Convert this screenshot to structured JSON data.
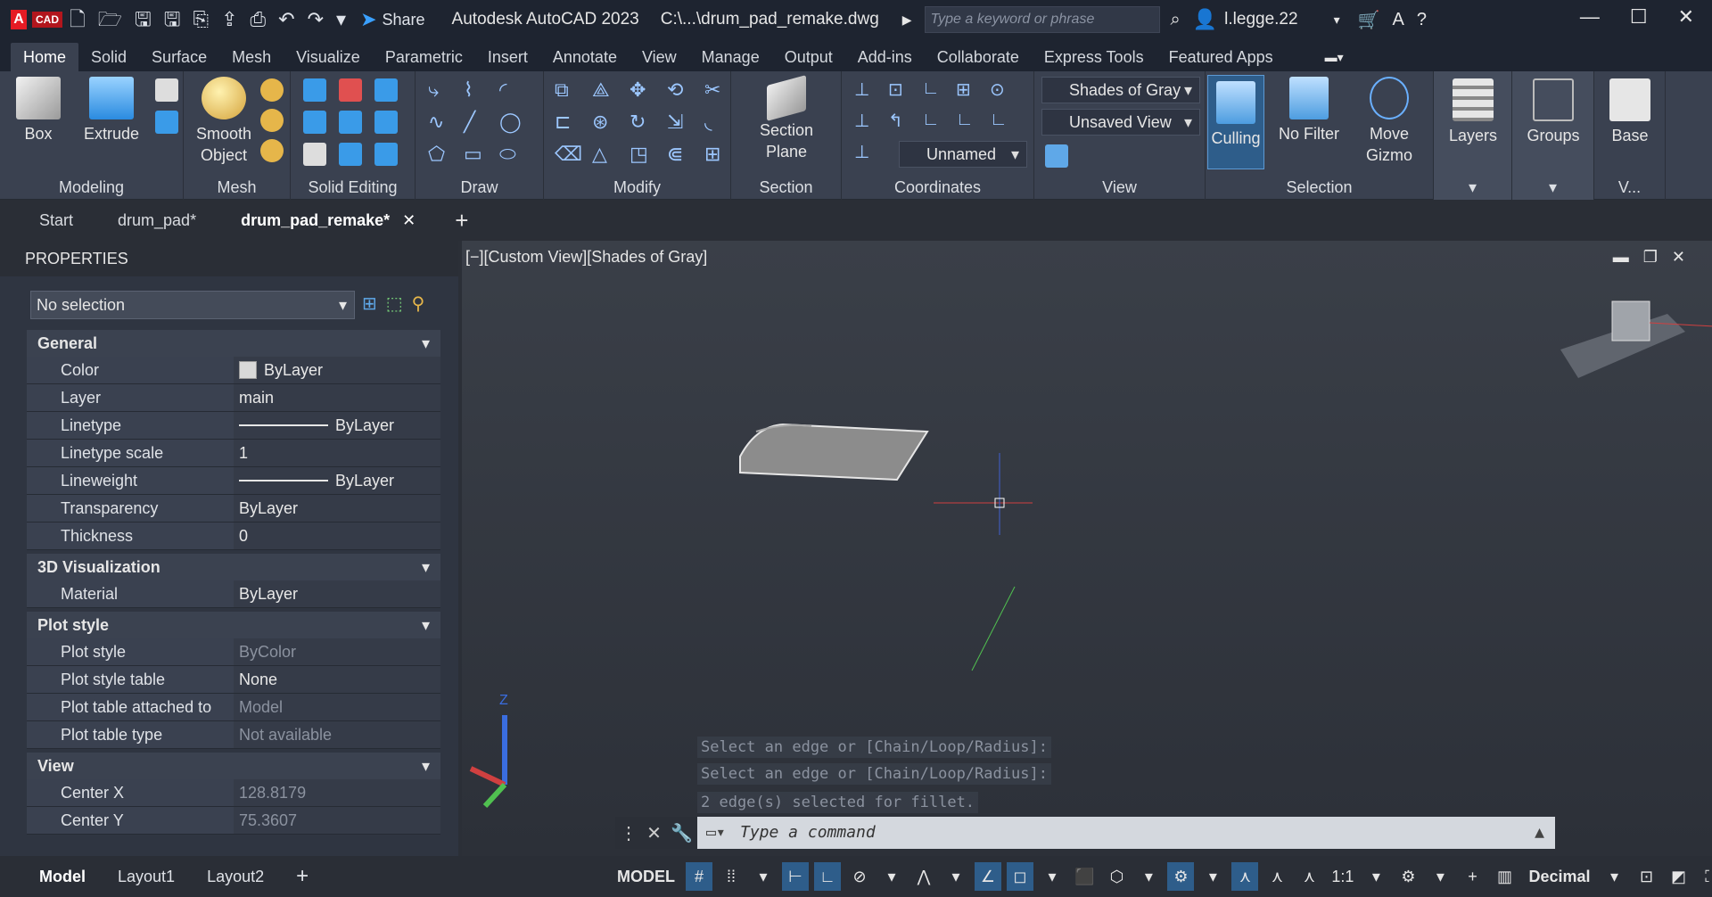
{
  "titlebar": {
    "app_letter": "A",
    "app_sub": "CAD",
    "share": "Share",
    "app_title": "Autodesk AutoCAD 2023",
    "file": "C:\\...\\drum_pad_remake.dwg",
    "search_placeholder": "Type a keyword or phrase",
    "user": "l.legge.22"
  },
  "ribbon_tabs": [
    "Home",
    "Solid",
    "Surface",
    "Mesh",
    "Visualize",
    "Parametric",
    "Insert",
    "Annotate",
    "View",
    "Manage",
    "Output",
    "Add-ins",
    "Collaborate",
    "Express Tools",
    "Featured Apps"
  ],
  "panels": {
    "modeling": {
      "title": "Modeling",
      "box": "Box",
      "extrude": "Extrude"
    },
    "mesh": {
      "title": "Mesh",
      "smooth": "Smooth",
      "object": "Object"
    },
    "solid_editing": {
      "title": "Solid Editing"
    },
    "draw": {
      "title": "Draw"
    },
    "modify": {
      "title": "Modify"
    },
    "section": {
      "title": "Section",
      "plane1": "Section",
      "plane2": "Plane"
    },
    "coordinates": {
      "title": "Coordinates",
      "ucs": "Unnamed"
    },
    "view": {
      "title": "View",
      "visual_style": "Shades of Gray",
      "named_view": "Unsaved View"
    },
    "selection": {
      "title": "Selection",
      "culling": "Culling",
      "nofilter": "No Filter",
      "move1": "Move",
      "move2": "Gizmo"
    },
    "layers": {
      "title": "Layers"
    },
    "groups": {
      "title": "Groups"
    },
    "base": {
      "title": "V...",
      "label": "Base"
    }
  },
  "doc_tabs": {
    "start": "Start",
    "tab1": "drum_pad*",
    "tab2": "drum_pad_remake*"
  },
  "properties": {
    "header": "PROPERTIES",
    "selection": "No selection",
    "general": {
      "title": "General",
      "rows": [
        {
          "k": "Color",
          "v": "ByLayer"
        },
        {
          "k": "Layer",
          "v": "main"
        },
        {
          "k": "Linetype",
          "v": "ByLayer"
        },
        {
          "k": "Linetype scale",
          "v": "1"
        },
        {
          "k": "Lineweight",
          "v": "ByLayer"
        },
        {
          "k": "Transparency",
          "v": "ByLayer"
        },
        {
          "k": "Thickness",
          "v": "0"
        }
      ]
    },
    "viz": {
      "title": "3D Visualization",
      "rows": [
        {
          "k": "Material",
          "v": "ByLayer"
        }
      ]
    },
    "plot": {
      "title": "Plot style",
      "rows": [
        {
          "k": "Plot style",
          "v": "ByColor"
        },
        {
          "k": "Plot style table",
          "v": "None"
        },
        {
          "k": "Plot table attached to",
          "v": "Model"
        },
        {
          "k": "Plot table type",
          "v": "Not available"
        }
      ]
    },
    "view": {
      "title": "View",
      "rows": [
        {
          "k": "Center X",
          "v": "128.8179"
        },
        {
          "k": "Center Y",
          "v": "75.3607"
        }
      ]
    }
  },
  "viewport": {
    "label": "[−][Custom View][Shades of Gray]",
    "history": [
      "Select an edge or [Chain/Loop/Radius]:",
      "Select an edge or [Chain/Loop/Radius]:",
      "2 edge(s) selected for fillet."
    ],
    "command_placeholder": "Type a command"
  },
  "status": {
    "layout_model": "Model",
    "layout1": "Layout1",
    "layout2": "Layout2",
    "model_btn": "MODEL",
    "scale": "1:1",
    "units": "Decimal"
  },
  "colors": {
    "accent": "#2e5d8a",
    "brand": "#e51b24"
  }
}
